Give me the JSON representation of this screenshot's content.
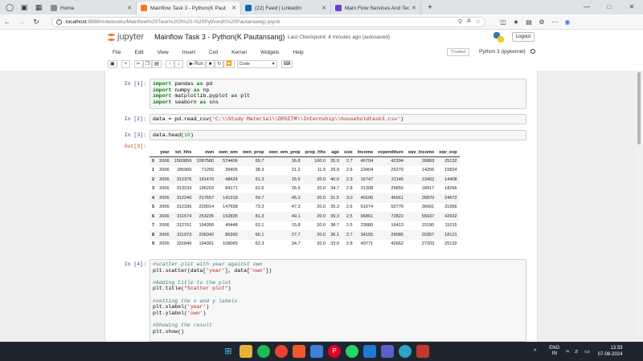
{
  "browser": {
    "tabs": [
      {
        "label": "Home",
        "favicon_color": "#8a8a8a",
        "active": false
      },
      {
        "label": "Mainflow Task 3 - Python(K Paut",
        "favicon_color": "#f37726",
        "active": true
      },
      {
        "label": "(22) Feed | LinkedIn",
        "favicon_color": "#0a66c2",
        "active": false
      },
      {
        "label": "Main Flow Services And Technolo",
        "favicon_color": "#6a3fd1",
        "active": false
      }
    ],
    "url_host": "localhost",
    "url_path": ":8888/notebooks/Mainflow%20Task%203%20-%20Python(K%20Pautansang).ipynb"
  },
  "jupyter": {
    "logo_text": "jupyter",
    "notebook_title": "Mainflow Task 3 - Python(K Pautansang)",
    "checkpoint": "Last Checkpoint: 4 minutes ago  (autosaved)",
    "logout_label": "Logout",
    "menu": [
      "File",
      "Edit",
      "View",
      "Insert",
      "Cell",
      "Kernel",
      "Widgets",
      "Help"
    ],
    "trusted_label": "Trusted",
    "kernel_label": "Python 3 (ipykernel)",
    "run_label": "Run",
    "cell_type": "Code"
  },
  "cells": {
    "c1": {
      "prompt": "In [1]:"
    },
    "c2": {
      "prompt": "In [2]:",
      "pre": "data = pd.read_csv(",
      "str": "'C:\\\\Study Material\\\\DPGITM\\\\Internship\\\\householdtask3.csv'",
      "post": ")"
    },
    "c3": {
      "prompt": "In [3]:",
      "pre": "data.head(",
      "num": "10",
      "post": ")",
      "out_prompt": "Out[3]:"
    },
    "c4": {
      "prompt": "In [4]:"
    }
  },
  "code1": [
    "pandas",
    "pd",
    "numpy",
    "np",
    "matplotlib.pyplot",
    "plt",
    "seaborn",
    "sns"
  ],
  "code4": {
    "c1": "#scatter plot with year against own",
    "l2a": "plt.scatter(data[",
    "l2s1": "'year'",
    "l2b": "], data[",
    "l2s2": "'own'",
    "l2c": "])",
    "c2": "#Adding title to the plot",
    "l5a": "plt.title(",
    "l5s": "\"Scatter plot\"",
    "l5b": ")",
    "c3": "#setting the x and y labels",
    "l8a": "plt.xlabel(",
    "l8s": "'year'",
    "l8b": ")",
    "l9a": "plt.ylabel(",
    "l9s": "'own'",
    "l9b": ")",
    "c4": "#Showing the result",
    "l12": "plt.show()"
  },
  "dataframe": {
    "columns": [
      "",
      "year",
      "tot_hhs",
      "own",
      "own_wm",
      "own_prop",
      "own_wm_prop",
      "prop_hhs",
      "age",
      "size",
      "income",
      "expenditure",
      "eqv_income",
      "eqv_exp"
    ],
    "rows": [
      [
        "0",
        "2006",
        "1560859",
        "1087580",
        "574406",
        "69.7",
        "36.8",
        "100.0",
        "35.9",
        "2.7",
        "46704",
        "42394",
        "26869",
        "25132"
      ],
      [
        "1",
        "2006",
        "185965",
        "71256",
        "39405",
        "38.3",
        "21.2",
        "11.9",
        "29.9",
        "2.6",
        "23404",
        "25270",
        "14256",
        "15824"
      ],
      [
        "2",
        "2006",
        "312376",
        "191470",
        "48424",
        "61.3",
        "15.5",
        "20.0",
        "40.0",
        "2.3",
        "16747",
        "21145",
        "13402",
        "14408"
      ],
      [
        "3",
        "2006",
        "313233",
        "196203",
        "84171",
        "62.6",
        "26.9",
        "20.0",
        "34.7",
        "2.8",
        "31308",
        "29855",
        "18917",
        "18266"
      ],
      [
        "4",
        "2006",
        "312240",
        "217657",
        "141318",
        "69.7",
        "45.3",
        "20.0",
        "31.5",
        "3.0",
        "49106",
        "46561",
        "26870",
        "24672"
      ],
      [
        "5",
        "2006",
        "312336",
        "229014",
        "147658",
        "73.3",
        "47.3",
        "20.0",
        "35.3",
        "2.6",
        "61674",
        "52776",
        "36691",
        "31956"
      ],
      [
        "6",
        "2006",
        "311574",
        "253235",
        "152835",
        "81.3",
        "49.1",
        "20.0",
        "39.3",
        "2.5",
        "96861",
        "72822",
        "55637",
        "42932"
      ],
      [
        "7",
        "2006",
        "312761",
        "194358",
        "49448",
        "62.1",
        "15.8",
        "20.0",
        "38.7",
        "2.5",
        "23680",
        "16413",
        "15190",
        "11015"
      ],
      [
        "8",
        "2006",
        "311973",
        "206342",
        "86390",
        "66.1",
        "27.7",
        "20.0",
        "36.1",
        "2.7",
        "34155",
        "29085",
        "20357",
        "18121"
      ],
      [
        "9",
        "2006",
        "331840",
        "194361",
        "108065",
        "62.3",
        "34.7",
        "20.0",
        "33.0",
        "2.8",
        "49771",
        "42662",
        "27203",
        "25132"
      ]
    ]
  },
  "taskbar": {
    "lang_1": "ENG",
    "lang_2": "IN",
    "time": "13:33",
    "date": "07-08-2024"
  }
}
